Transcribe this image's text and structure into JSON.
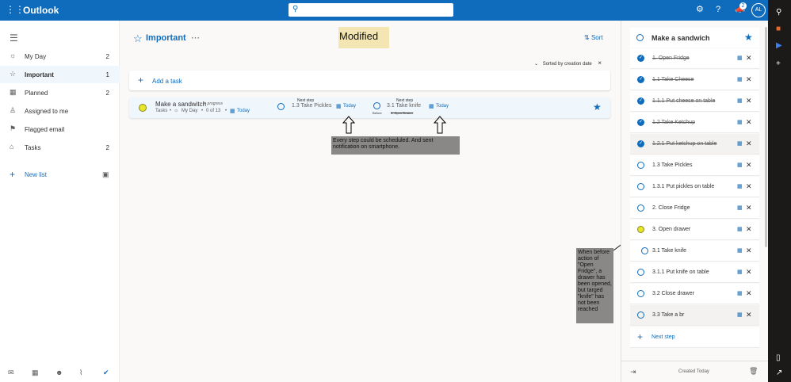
{
  "app": {
    "name": "Outlook"
  },
  "header": {
    "search_placeholder": "",
    "badge_count": "2",
    "avatar_initials": "AL"
  },
  "sidebar": {
    "items": [
      {
        "label": "My Day",
        "count": "2"
      },
      {
        "label": "Important",
        "count": "1"
      },
      {
        "label": "Planned",
        "count": "2"
      },
      {
        "label": "Assigned to me",
        "count": ""
      },
      {
        "label": "Flagged email",
        "count": ""
      },
      {
        "label": "Tasks",
        "count": "2"
      }
    ],
    "new_list": "New list"
  },
  "main": {
    "title": "Important",
    "annotation_label": "Modified",
    "sort_label": "Sort",
    "sorted_by": "Sorted by creation date",
    "add_task": "Add a task",
    "task": {
      "title": "Make a sandwitch",
      "status": "In progress",
      "list": "Tasks",
      "myday": "My Day",
      "progress": "0 of 13",
      "due": "Today",
      "next_step_label_1": "Next step",
      "next_step_1": "1.3 Take Pickles",
      "next_step_due_1": "Today",
      "next_step_label_2": "Next step",
      "next_step_2": "3.1 Take knife",
      "next_step_due_2": "Today",
      "before_label": "Before",
      "before_value": "3. Open Drawer"
    },
    "callout_1": "Every step could be scheduled. And sent notification on smartphone.",
    "callout_2": "When before action of \"Open Fridge\", a drawer has been opened, but targed \"knife\" has not been reached"
  },
  "detail": {
    "title": "Make a sandwich",
    "steps": [
      {
        "label": "1. Open Fridge",
        "done": true
      },
      {
        "label": "1.1 Take Cheese",
        "done": true
      },
      {
        "label": "1.1.1 Put cheese on table",
        "done": true
      },
      {
        "label": "1.2 Take Ketchup",
        "done": true
      },
      {
        "label": "1.2.1 Put ketchup on table",
        "done": true
      },
      {
        "label": "1.3 Take Pickles",
        "done": false
      },
      {
        "label": "1.3.1 Put pickles on table",
        "done": false
      },
      {
        "label": "2. Close Fridge",
        "done": false
      },
      {
        "label": "3. Open drawer",
        "done": false
      },
      {
        "label": "3.1 Take knife",
        "done": false
      },
      {
        "label": "3.1.1 Put knife on table",
        "done": false
      },
      {
        "label": "3.2 Close drawer",
        "done": false
      },
      {
        "label": "3.3 Take a br",
        "done": false
      }
    ],
    "next_step": "Next step",
    "created": "Created Today"
  }
}
